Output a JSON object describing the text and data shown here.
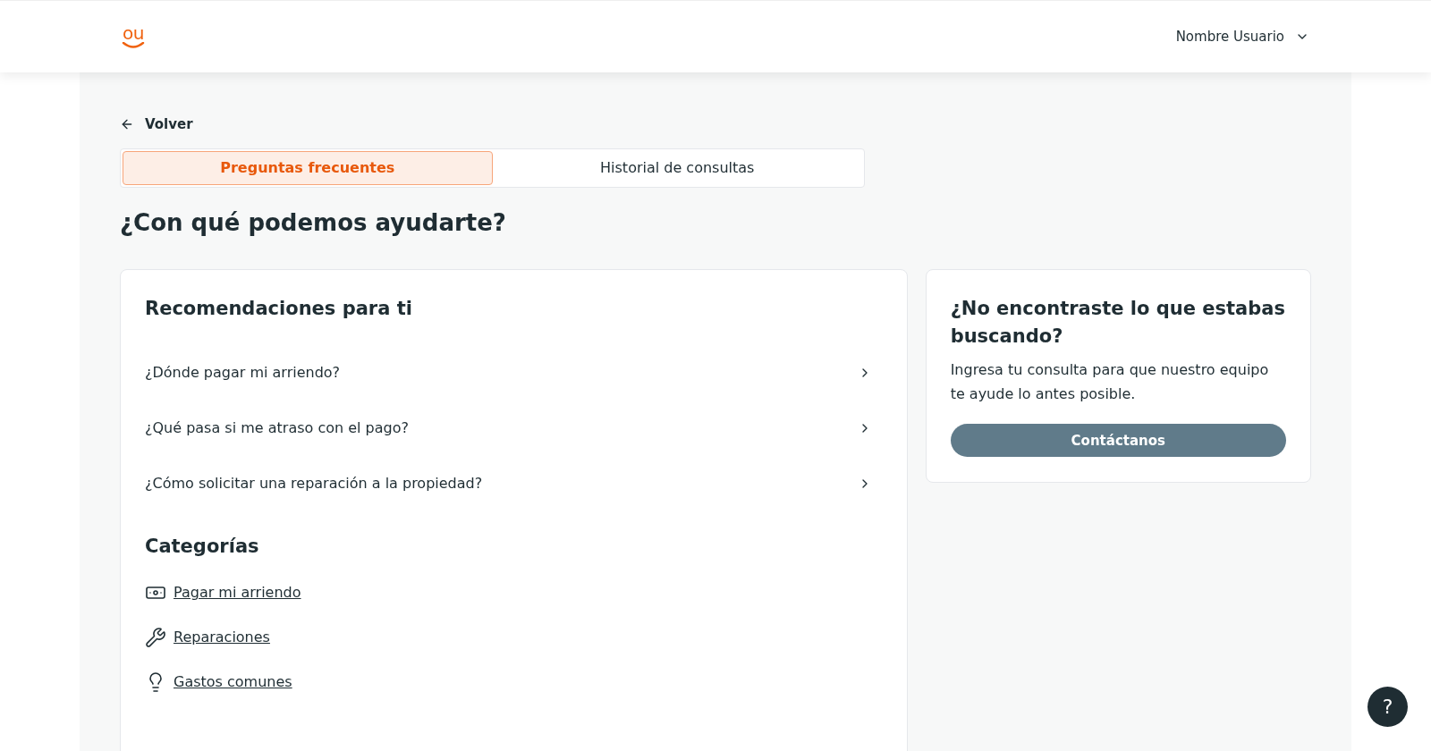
{
  "header": {
    "logo": "ou",
    "user_name": "Nombre Usuario"
  },
  "back_link": "Volver",
  "tabs": [
    {
      "label": "Preguntas frecuentes",
      "selected": true
    },
    {
      "label": "Historial de consultas",
      "selected": false
    }
  ],
  "title": "¿Con qué podemos ayudarte?",
  "recommendations": {
    "title": "Recomendaciones para ti",
    "items": [
      "¿Dónde pagar mi arriendo?",
      "¿Qué pasa si me atraso con el pago?",
      "¿Cómo solicitar una reparación a la propiedad?"
    ]
  },
  "categories": {
    "title": "Categorías",
    "items": [
      {
        "kind": "money",
        "label": "Pagar mi arriendo"
      },
      {
        "kind": "tools",
        "label": "Reparaciones"
      },
      {
        "kind": "bulb",
        "label": "Gastos comunes"
      }
    ]
  },
  "contact_card": {
    "title": "¿No encontraste lo que estabas buscando?",
    "text": "Ingresa tu consulta para que nuestro equipo te ayude lo antes posible.",
    "button": "Contáctanos"
  },
  "help_button": "?"
}
